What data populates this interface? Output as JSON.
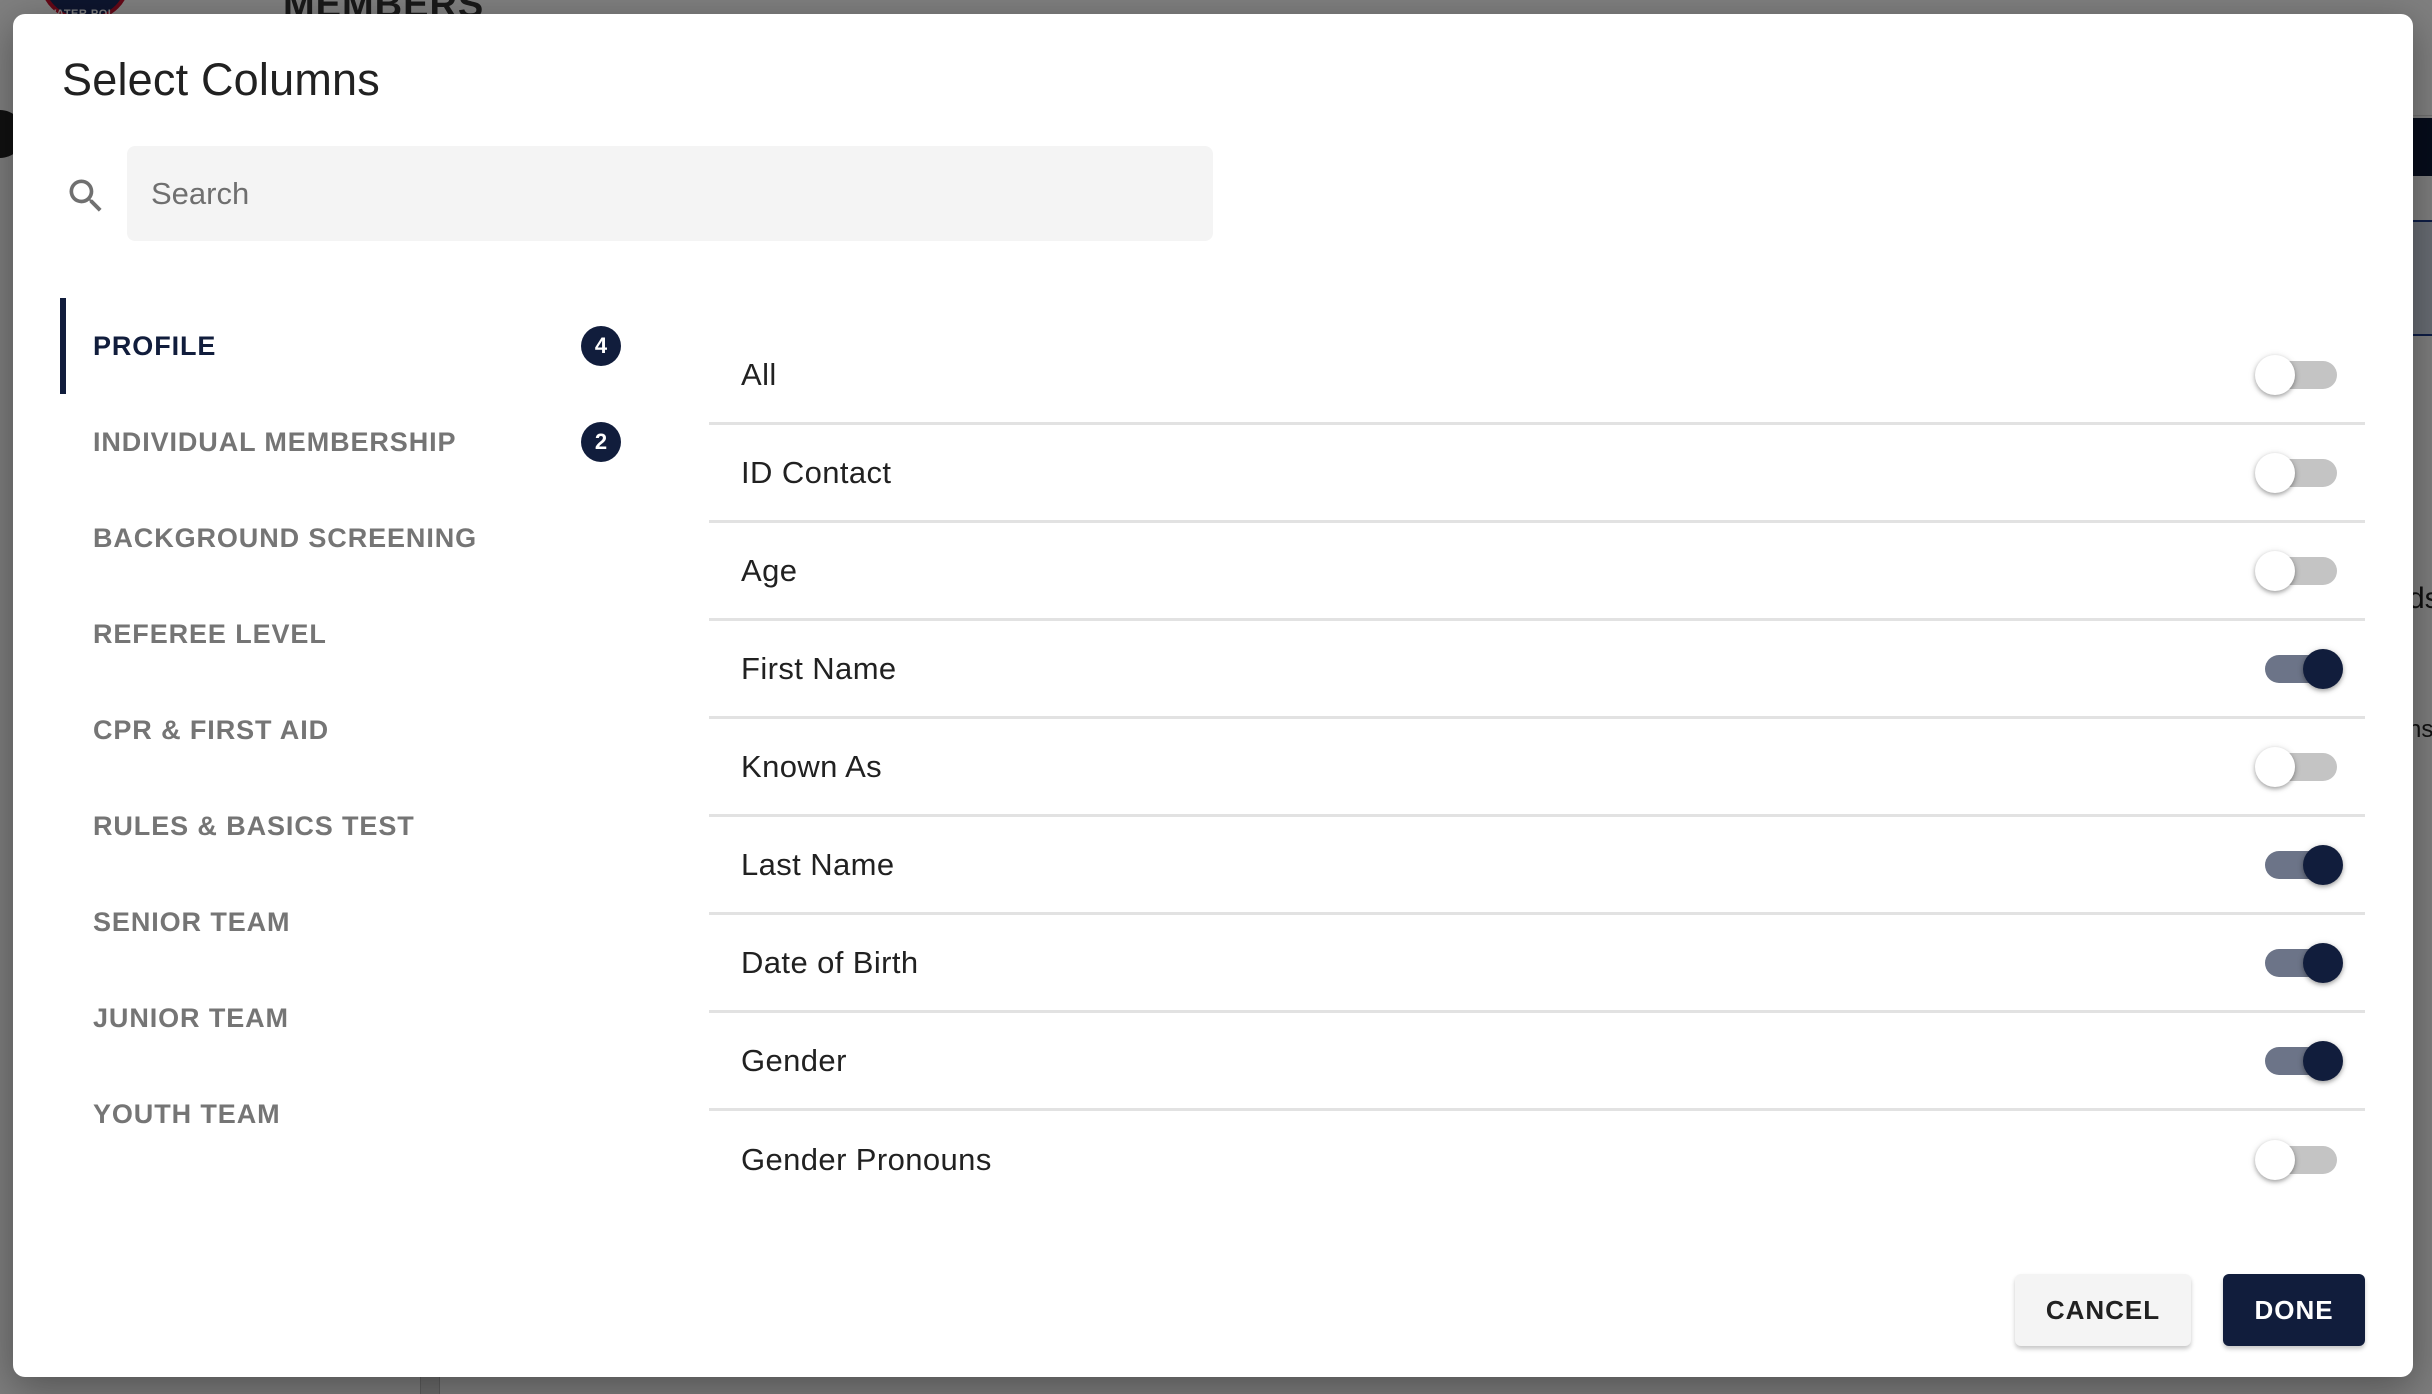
{
  "background": {
    "logo_text": "WATER POLO",
    "page_title": "MEMBERS",
    "fragment_1": "ds",
    "fragment_2": "ns"
  },
  "dialog": {
    "title": "Select Columns",
    "search": {
      "placeholder": "Search",
      "value": "",
      "icon": "search-icon"
    },
    "categories": [
      {
        "label": "PROFILE",
        "badge": "4",
        "active": true
      },
      {
        "label": "INDIVIDUAL MEMBERSHIP",
        "badge": "2",
        "active": false
      },
      {
        "label": "BACKGROUND SCREENING",
        "badge": null,
        "active": false
      },
      {
        "label": "REFEREE LEVEL",
        "badge": null,
        "active": false
      },
      {
        "label": "CPR & FIRST AID",
        "badge": null,
        "active": false
      },
      {
        "label": "RULES & BASICS TEST",
        "badge": null,
        "active": false
      },
      {
        "label": "SENIOR TEAM",
        "badge": null,
        "active": false
      },
      {
        "label": "JUNIOR TEAM",
        "badge": null,
        "active": false
      },
      {
        "label": "YOUTH TEAM",
        "badge": null,
        "active": false
      }
    ],
    "columns": [
      {
        "label": "All",
        "enabled": false
      },
      {
        "label": "ID Contact",
        "enabled": false
      },
      {
        "label": "Age",
        "enabled": false
      },
      {
        "label": "First Name",
        "enabled": true
      },
      {
        "label": "Known As",
        "enabled": false
      },
      {
        "label": "Last Name",
        "enabled": true
      },
      {
        "label": "Date of Birth",
        "enabled": true
      },
      {
        "label": "Gender",
        "enabled": true
      },
      {
        "label": "Gender Pronouns",
        "enabled": false
      }
    ],
    "buttons": {
      "cancel": "CANCEL",
      "done": "DONE"
    }
  },
  "colors": {
    "accent": "#111d3c",
    "toggle_on_track": "#6c7488",
    "toggle_off_track": "#c4c4c4",
    "inactive_text": "#757575",
    "search_bg": "#f4f4f4"
  }
}
